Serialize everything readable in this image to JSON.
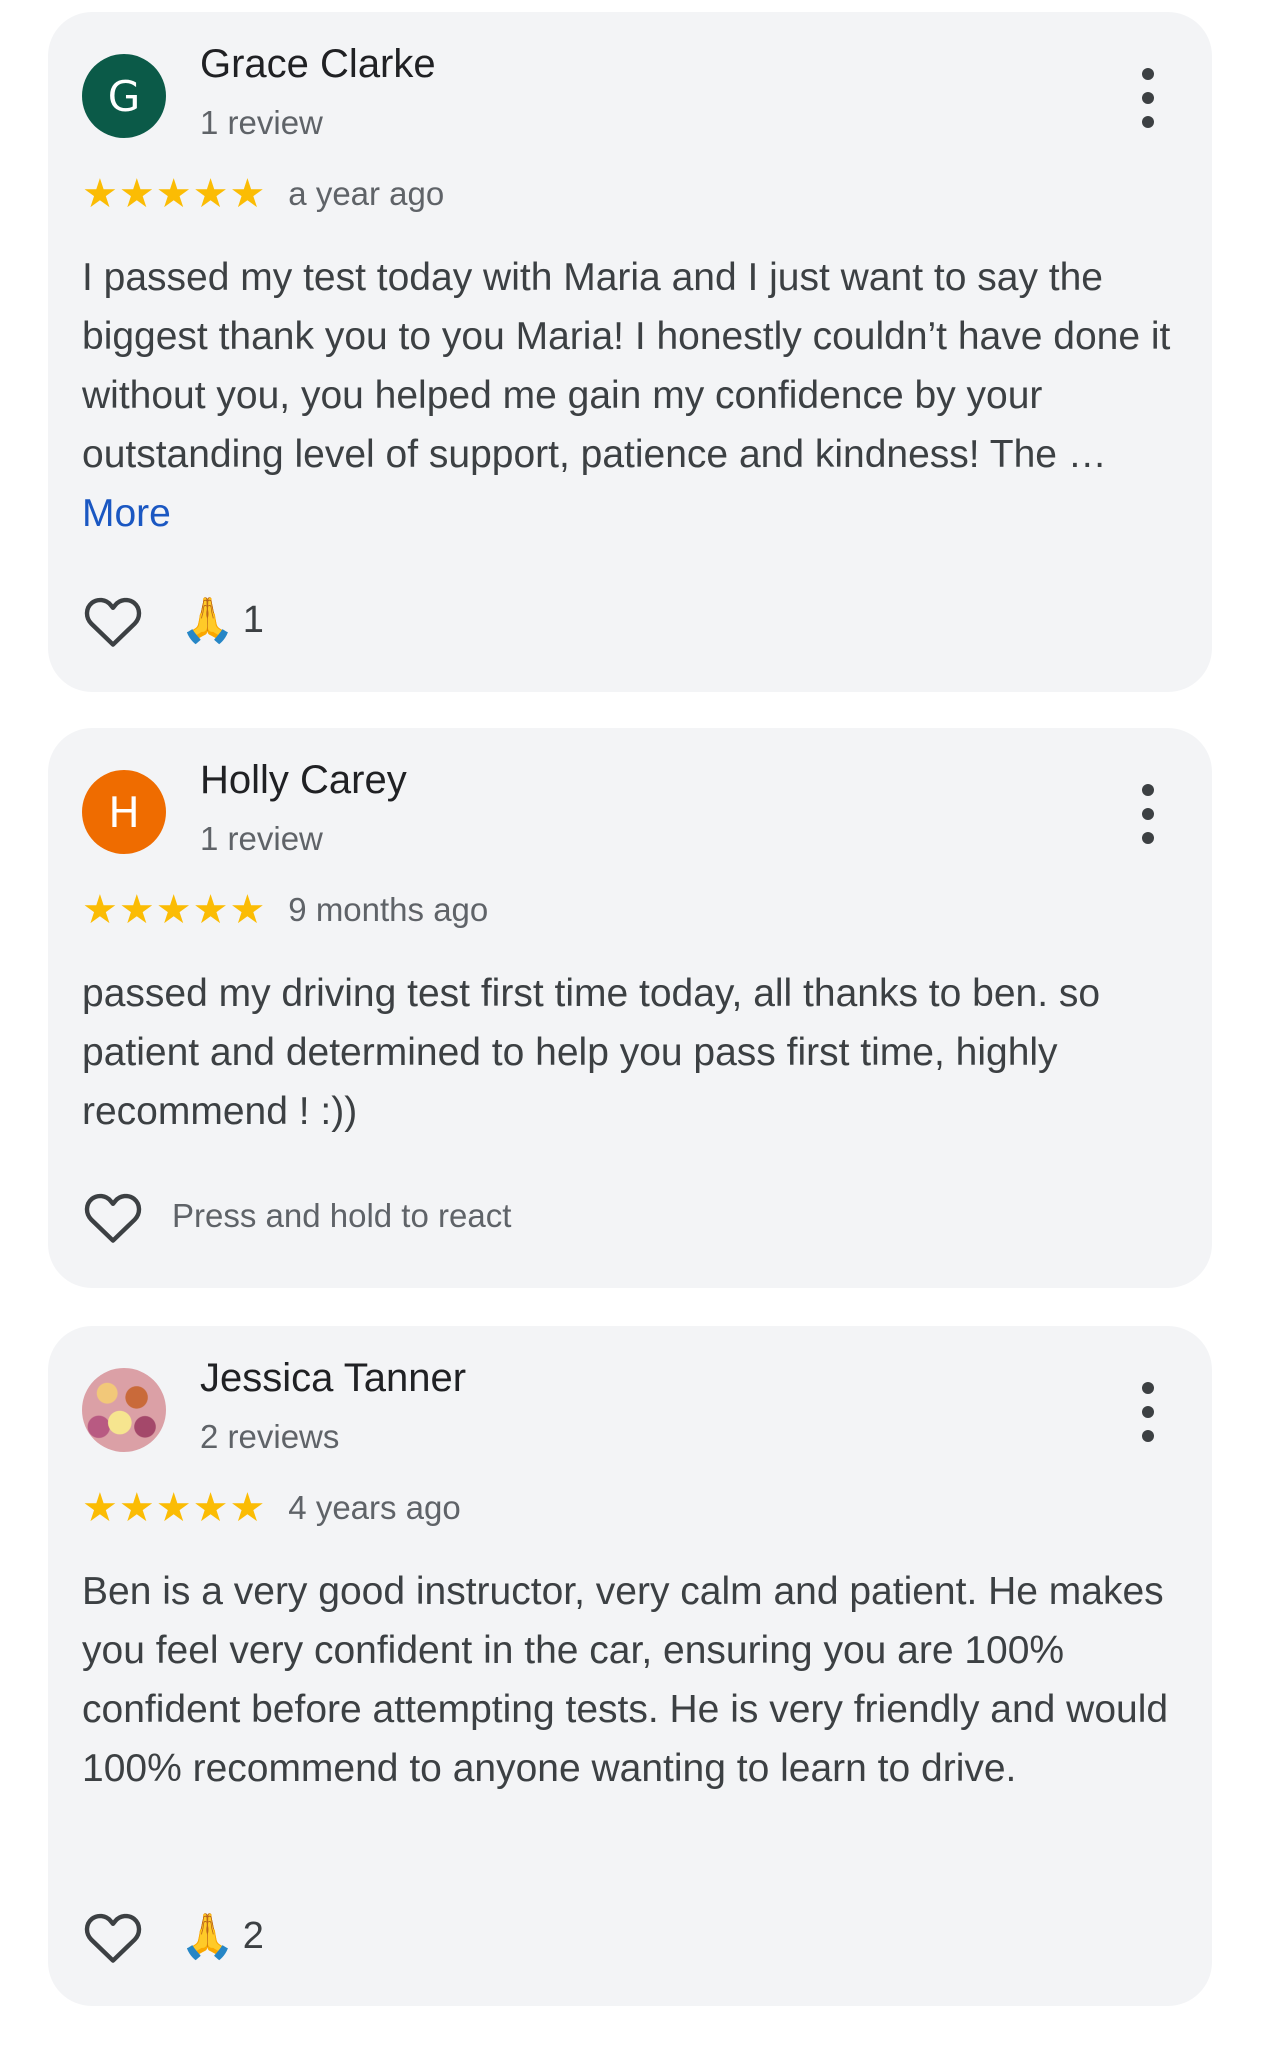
{
  "reviews": [
    {
      "avatar_letter": "G",
      "avatar_color": "#0b5a48",
      "name": "Grace Clarke",
      "review_count": "1 review",
      "stars": "★★★★★",
      "rating": 5,
      "time": "a year ago",
      "text": "I passed my test today with Maria and I just want to say the biggest thank you to you Maria! I honestly couldn’t have done it without you, you helped me gain my confidence by your outstanding level of support, patience and kindness! The … ",
      "more_label": "More",
      "reaction_emoji": "🙏",
      "reaction_count": "1"
    },
    {
      "avatar_letter": "H",
      "avatar_color": "#ef6c00",
      "name": "Holly Carey",
      "review_count": "1 review",
      "stars": "★★★★★",
      "rating": 5,
      "time": "9 months ago",
      "text": "passed my driving test first time today, all thanks to ben. so patient and determined to help you pass first time, highly recommend ! :))",
      "press_hint": "Press and hold to react"
    },
    {
      "name": "Jessica Tanner",
      "review_count": "2 reviews",
      "stars": "★★★★★",
      "rating": 5,
      "time": "4 years ago",
      "text": "Ben is a very good instructor, very calm and patient. He makes you feel very confident in the car, ensuring you are 100% confident before attempting tests. He is very friendly and would 100% recommend to anyone wanting to learn to drive.",
      "reaction_emoji": "🙏",
      "reaction_count": "2"
    }
  ],
  "icons": {
    "menu": "more-vert-icon",
    "heart": "heart-outline-icon",
    "star": "star-icon",
    "pray": "folded-hands-icon"
  },
  "colors": {
    "star": "#fbbc04",
    "link": "#1a57c2",
    "card_bg": "#f3f4f6"
  }
}
